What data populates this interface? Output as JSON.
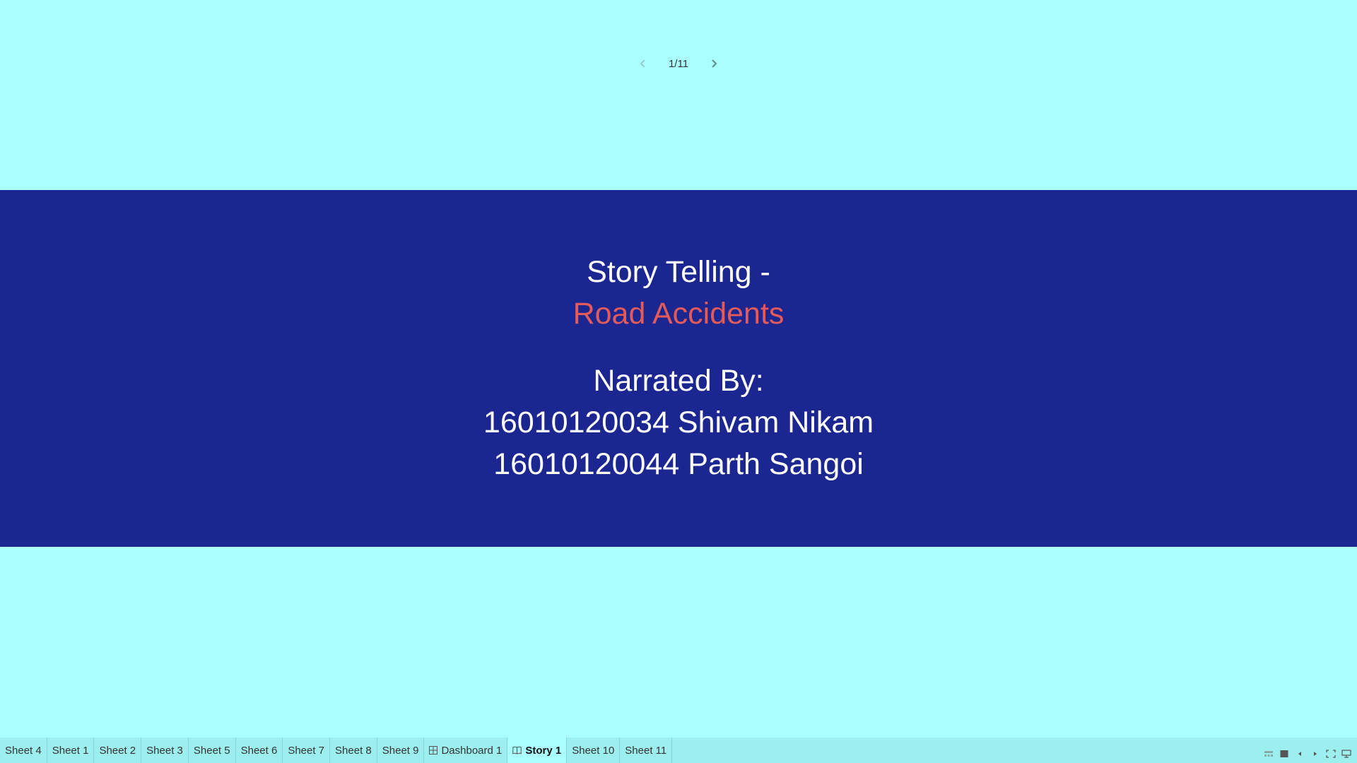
{
  "story_nav": {
    "page_counter": "1/11",
    "prev_icon": "chevron-left-icon",
    "next_icon": "chevron-right-icon"
  },
  "title": {
    "line1": "Story Telling -",
    "line2": "Road Accidents"
  },
  "narrators": {
    "heading": "Narrated By:",
    "people": [
      "16010120034 Shivam Nikam",
      "16010120044 Parth Sangoi"
    ]
  },
  "tabs": [
    {
      "label": "Sheet 4"
    },
    {
      "label": "Sheet 1"
    },
    {
      "label": "Sheet 2"
    },
    {
      "label": "Sheet 3"
    },
    {
      "label": "Sheet 5"
    },
    {
      "label": "Sheet 6"
    },
    {
      "label": "Sheet 7"
    },
    {
      "label": "Sheet 8"
    },
    {
      "label": "Sheet 9"
    },
    {
      "label": "Dashboard 1",
      "icon": "dashboard-icon"
    },
    {
      "label": "Story 1",
      "icon": "story-icon",
      "active": true
    },
    {
      "label": "Sheet 10"
    },
    {
      "label": "Sheet 11"
    }
  ],
  "toolbar_icons": [
    "filmstrip-icon",
    "single-sheet-icon",
    "previous-icon",
    "next-icon",
    "fullscreen-icon",
    "presentation-icon"
  ],
  "colors": {
    "background": "#aaffff",
    "band": "#1b2690",
    "accent": "#e25a5a",
    "tab_bar": "#9deeee"
  }
}
